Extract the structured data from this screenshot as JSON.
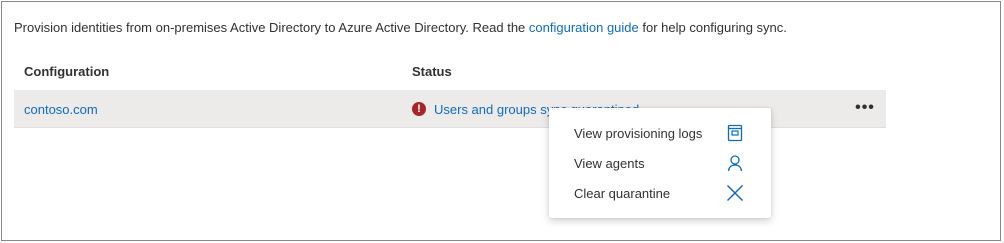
{
  "intro": {
    "text_before": "Provision identities from on-premises Active Directory to Azure Active Directory. Read the ",
    "link_text": "configuration guide",
    "text_after": " for help configuring sync."
  },
  "table": {
    "headers": {
      "configuration": "Configuration",
      "status": "Status"
    },
    "rows": [
      {
        "configuration": "contoso.com",
        "status": "Users and groups sync quarantined",
        "status_icon": "error-icon"
      }
    ]
  },
  "more_menu": {
    "trigger": "•••",
    "items": [
      {
        "label": "View provisioning logs",
        "icon": "logs-icon"
      },
      {
        "label": "View agents",
        "icon": "person-icon"
      },
      {
        "label": "Clear quarantine",
        "icon": "close-icon"
      }
    ]
  },
  "colors": {
    "link": "#0f6cbd",
    "error": "#a4262c",
    "row_highlight": "#edebe9"
  }
}
